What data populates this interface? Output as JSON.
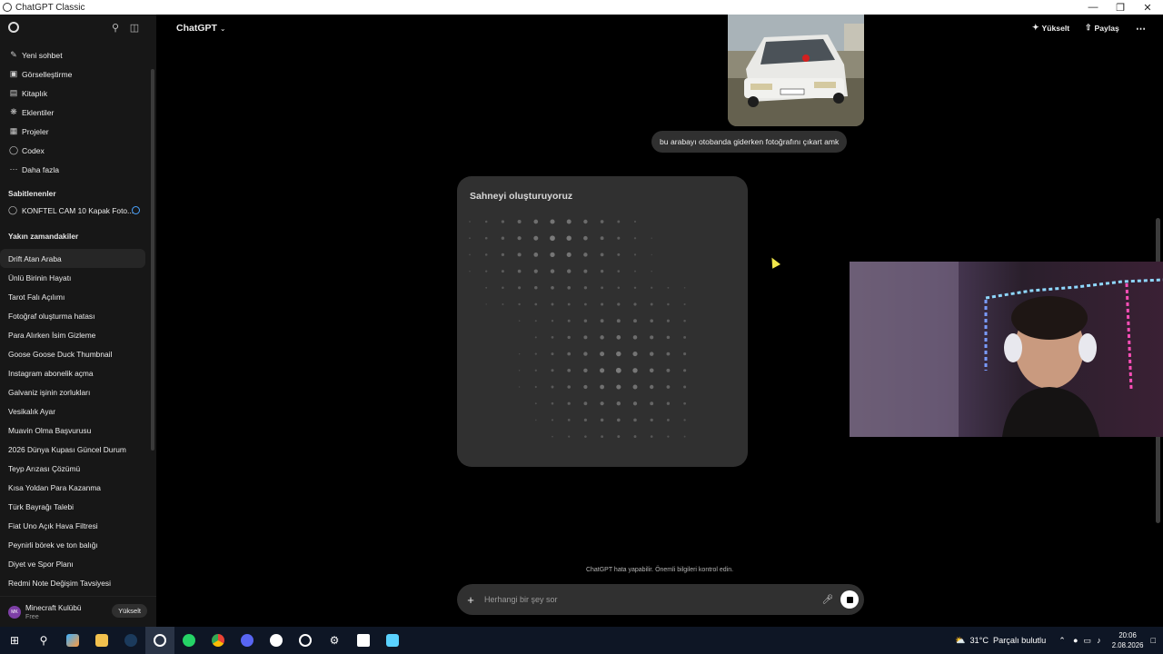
{
  "window": {
    "title": "ChatGPT Classic"
  },
  "sidebar": {
    "nav": [
      {
        "icon": "new-chat-icon",
        "label": "Yeni sohbet"
      },
      {
        "icon": "image-icon",
        "label": "Görselleştirme"
      },
      {
        "icon": "library-icon",
        "label": "Kitaplık"
      },
      {
        "icon": "apps-icon",
        "label": "Eklentiler"
      },
      {
        "icon": "folder-icon",
        "label": "Projeler"
      },
      {
        "icon": "codex-icon",
        "label": "Codex"
      },
      {
        "icon": "more-icon",
        "label": "Daha fazla"
      }
    ],
    "pinned_title": "Sabitlenenler",
    "pinned_item": "KONFTEL CAM 10 Kapak Foto...",
    "recent_title": "Yakın zamandakiler",
    "chats": [
      "Drift Atan Araba",
      "Ünlü Birinin Hayatı",
      "Tarot Falı Açılımı",
      "Fotoğraf oluşturma hatası",
      "Para Alırken İsim Gizleme",
      "Goose Goose Duck Thumbnail",
      "Instagram abonelik açma",
      "Galvaniz işinin zorlukları",
      "Vesikalık Ayar",
      "Muavin Olma Başvurusu",
      "2026 Dünya Kupası Güncel Durum",
      "Teyp Arızası Çözümü",
      "Kısa Yoldan Para Kazanma",
      "Türk Bayrağı Talebi",
      "Fiat Uno Açık Hava Filtresi",
      "Peynirli börek ve ton balığı",
      "Diyet ve Spor Planı",
      "Redmi Note Değişim Tavsiyesi"
    ],
    "user": {
      "initials": "MK",
      "name": "Minecraft Kulübü",
      "plan": "Free",
      "upgrade_label": "Yükselt"
    }
  },
  "header": {
    "model": "ChatGPT",
    "upgrade_label": "Yükselt",
    "share_label": "Paylaş"
  },
  "conversation": {
    "user_message": "bu arabayı otobanda giderken fotoğrafını çıkart amk",
    "generating_title": "Sahneyi oluşturuyoruz"
  },
  "composer": {
    "placeholder": "Herhangi bir şey sor",
    "disclaimer": "ChatGPT hata yapabilir. Önemli bilgileri kontrol edin."
  },
  "taskbar": {
    "weather_temp": "31°C",
    "weather_text": "Parçalı bulutlu",
    "time": "20:06",
    "date": "2.08.2026"
  }
}
